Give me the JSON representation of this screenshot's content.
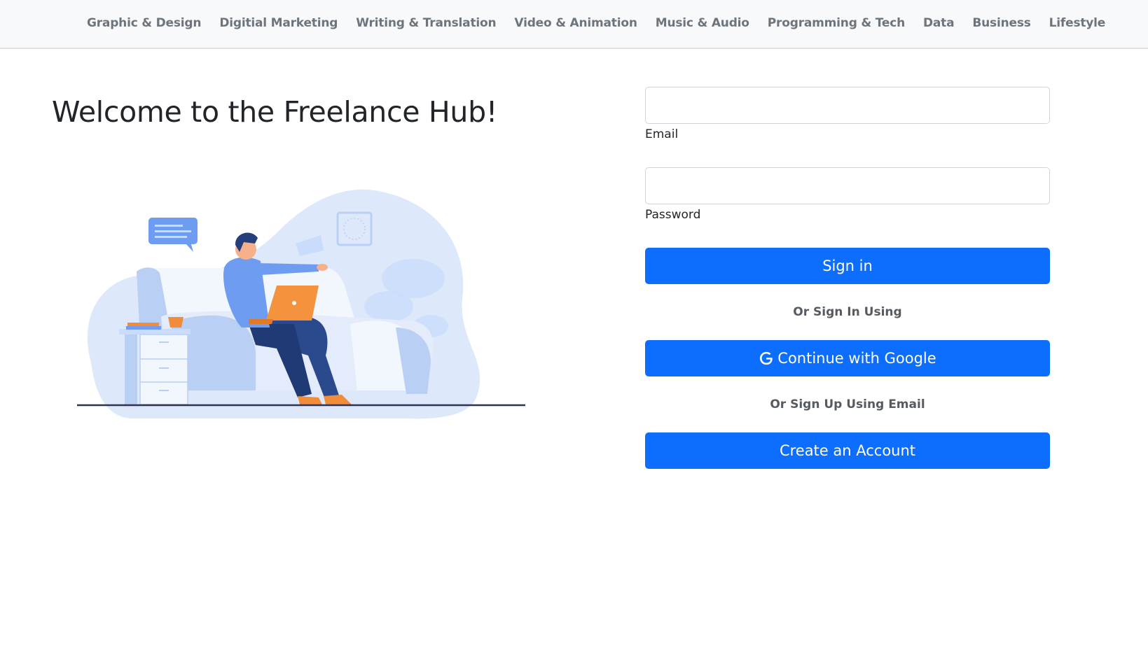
{
  "nav": {
    "items": [
      {
        "label": "Graphic & Design"
      },
      {
        "label": "Digitial Marketing"
      },
      {
        "label": "Writing & Translation"
      },
      {
        "label": "Video & Animation"
      },
      {
        "label": "Music & Audio"
      },
      {
        "label": "Programming & Tech"
      },
      {
        "label": "Data"
      },
      {
        "label": "Business"
      },
      {
        "label": "Lifestyle"
      }
    ]
  },
  "hero": {
    "title": "Welcome to the Freelance Hub!",
    "illustration_icon": "person-with-laptop-on-couch-illustration"
  },
  "form": {
    "email_label": "Email",
    "email_value": "",
    "password_label": "Password",
    "password_value": "",
    "signin_label": "Sign in",
    "or_signin_text": "Or Sign In Using",
    "google_label": "Continue with Google",
    "google_icon": "google-icon",
    "or_signup_text": "Or Sign Up Using Email",
    "create_account_label": "Create an Account"
  },
  "colors": {
    "primary": "#0d6efd",
    "nav_bg": "#f8f9fa",
    "nav_text": "#6c757d"
  }
}
